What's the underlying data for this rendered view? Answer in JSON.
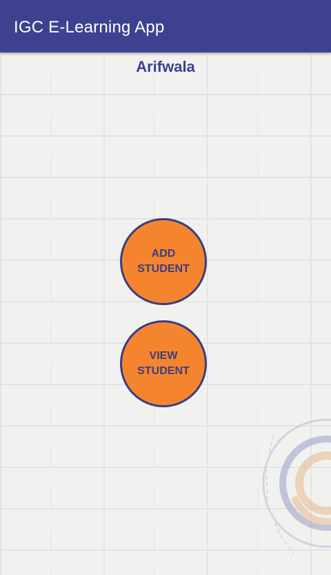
{
  "app_bar": {
    "title": "IGC E-Learning App"
  },
  "header": {
    "campus": "Arifwala"
  },
  "actions": {
    "add_student": "ADD\nSTUDENT",
    "view_student": "VIEW\nSTUDENT"
  },
  "colors": {
    "app_bar": "#3e4190",
    "accent_orange": "#f4852e",
    "button_border": "#3b3c82"
  },
  "icons": {
    "watermark": "igc-logo-watermark"
  }
}
